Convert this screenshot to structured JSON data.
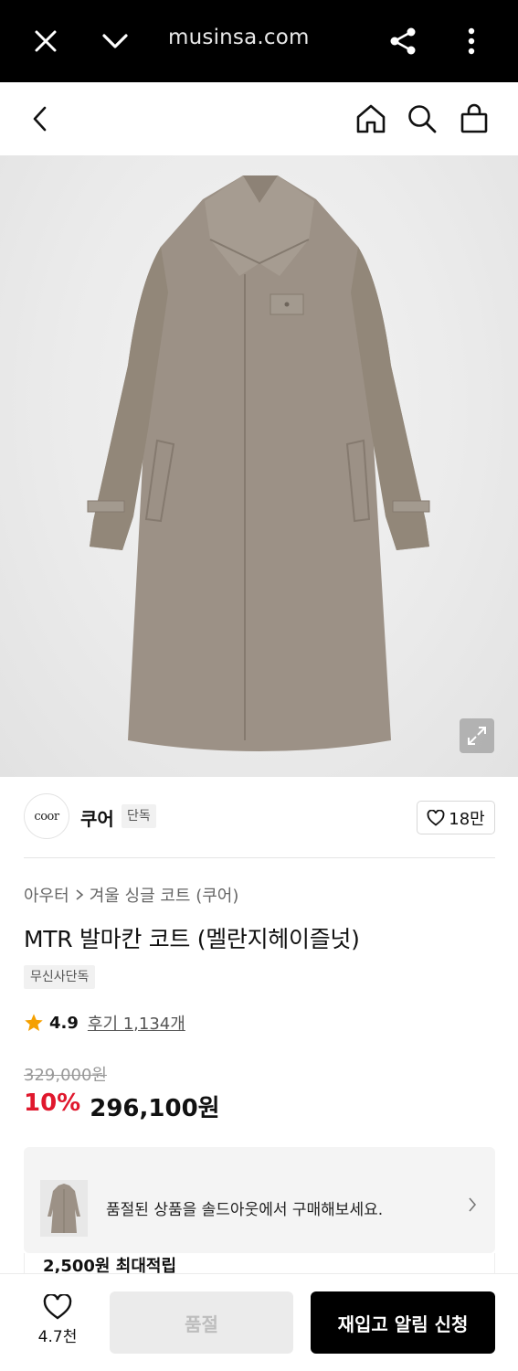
{
  "browser": {
    "url": "musinsa.com",
    "icons": [
      "close-icon",
      "chevron-down-icon",
      "share-icon",
      "more-vertical-icon"
    ]
  },
  "header": {
    "icons": [
      "back-icon",
      "home-icon",
      "search-icon",
      "cart-icon"
    ]
  },
  "brand": {
    "logo_text": "coor",
    "name": "쿠어",
    "badge": "단독",
    "likes": "18만"
  },
  "breadcrumb": {
    "category": "아우터",
    "subcategory": "겨울 싱글 코트 (쿠어)"
  },
  "product": {
    "title": "MTR 발마칸 코트 (멜란지헤이즐넛)",
    "tag": "무신사단독",
    "rating": "4.9",
    "reviews": "후기 1,134개",
    "original_price": "329,000원",
    "discount": "10%",
    "price": "296,100원"
  },
  "soldout_banner": {
    "text": "품절된 상품을 솔드아웃에서 구매해보세요."
  },
  "points": {
    "text": "2,500원 최대적립"
  },
  "bottom_bar": {
    "wish_count": "4.7천",
    "soldout_label": "품절",
    "restock_label": "재입고 알림 신청"
  },
  "colors": {
    "accent_red": "#e0182d",
    "star": "#f5a000",
    "coat": "#9c9186"
  }
}
